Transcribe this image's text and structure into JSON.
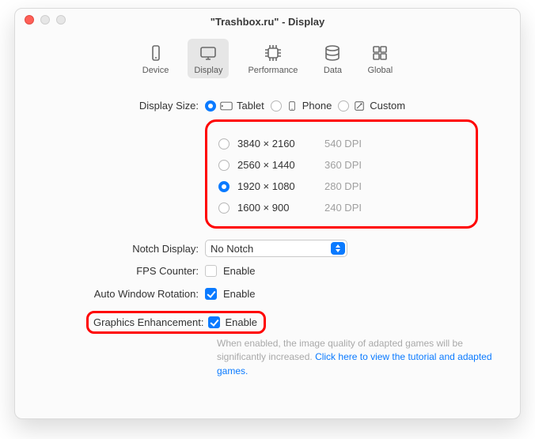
{
  "window": {
    "title": "\"Trashbox.ru\" - Display"
  },
  "toolbar": {
    "items": [
      {
        "label": "Device"
      },
      {
        "label": "Display"
      },
      {
        "label": "Performance"
      },
      {
        "label": "Data"
      },
      {
        "label": "Global"
      }
    ],
    "selected_index": 1
  },
  "display_size": {
    "label": "Display Size:",
    "options": [
      {
        "label": "Tablet"
      },
      {
        "label": "Phone"
      },
      {
        "label": "Custom"
      }
    ],
    "selected_index": 0
  },
  "resolutions": {
    "options": [
      {
        "res": "3840 × 2160",
        "dpi": "540 DPI"
      },
      {
        "res": "2560 × 1440",
        "dpi": "360 DPI"
      },
      {
        "res": "1920 × 1080",
        "dpi": "280 DPI"
      },
      {
        "res": "1600 × 900",
        "dpi": "240 DPI"
      }
    ],
    "selected_index": 2
  },
  "notch": {
    "label": "Notch Display:",
    "value": "No Notch"
  },
  "fps": {
    "label": "FPS Counter:",
    "checkbox_label": "Enable",
    "checked": false
  },
  "rotation": {
    "label": "Auto Window Rotation:",
    "checkbox_label": "Enable",
    "checked": true
  },
  "graphics": {
    "label": "Graphics Enhancement:",
    "checkbox_label": "Enable",
    "checked": true,
    "help_prefix": "When enabled, the image quality of adapted games will be significantly increased. ",
    "help_link": "Click here to view the tutorial and adapted games."
  }
}
